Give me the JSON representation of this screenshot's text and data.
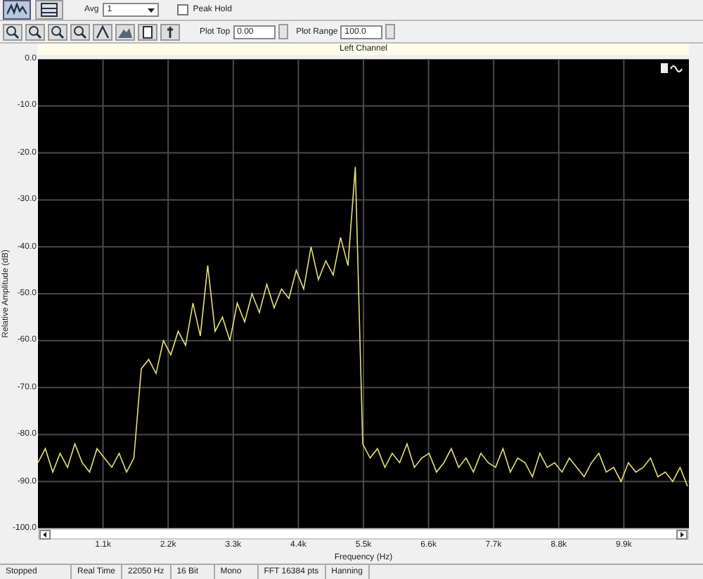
{
  "toolbar": {
    "view_buttons": [
      {
        "selected": true
      },
      {
        "selected": false
      }
    ],
    "avg": {
      "label": "Avg",
      "value": "1"
    },
    "peak_hold": {
      "label": "Peak Hold",
      "checked": false
    },
    "plot_top": {
      "label": "Plot Top",
      "value": "0.00"
    },
    "plot_range": {
      "label": "Plot Range",
      "value": "100.0"
    }
  },
  "plot": {
    "chart_data": {
      "type": "line",
      "title": "Left Channel",
      "xlabel": "Frequency (Hz)",
      "ylabel": "Relative Amplitude (dB)",
      "x": [
        0,
        125,
        250,
        375,
        500,
        625,
        750,
        875,
        1000,
        1125,
        1250,
        1375,
        1500,
        1625,
        1750,
        1875,
        2000,
        2125,
        2250,
        2375,
        2500,
        2625,
        2750,
        2875,
        3000,
        3125,
        3250,
        3375,
        3500,
        3625,
        3750,
        3875,
        4000,
        4125,
        4250,
        4375,
        4500,
        4625,
        4750,
        4875,
        5000,
        5125,
        5250,
        5375,
        5500,
        5625,
        5750,
        5875,
        6000,
        6125,
        6250,
        6375,
        6500,
        6625,
        6750,
        6875,
        7000,
        7125,
        7250,
        7375,
        7500,
        7625,
        7750,
        7875,
        8000,
        8125,
        8250,
        8375,
        8500,
        8625,
        8750,
        8875,
        9000,
        9125,
        9250,
        9375,
        9500,
        9625,
        9750,
        9875,
        10000,
        10125,
        10250,
        10375,
        10500,
        10625,
        10750,
        10875,
        11000
      ],
      "grid": true,
      "series": [
        {
          "color": "#e8e070",
          "values": [
            -86,
            -83,
            -88,
            -84,
            -87,
            -82,
            -86,
            -88,
            -83,
            -85,
            -87,
            -84,
            -88,
            -85,
            -66,
            -64,
            -67,
            -60,
            -63,
            -58,
            -61,
            -52,
            -59,
            -44,
            -58,
            -55,
            -60,
            -52,
            -56,
            -50,
            -54,
            -48,
            -53,
            -49,
            -51,
            -45,
            -49,
            -40,
            -47,
            -43,
            -46,
            -38,
            -44,
            -23,
            -82,
            -85,
            -83,
            -87,
            -84,
            -86,
            -82,
            -87,
            -85,
            -84,
            -88,
            -86,
            -83,
            -87,
            -85,
            -88,
            -84,
            -86,
            -87,
            -83,
            -88,
            -85,
            -86,
            -89,
            -84,
            -87,
            -86,
            -88,
            -85,
            -87,
            -89,
            -86,
            -84,
            -88,
            -87,
            -90,
            -86,
            -88,
            -87,
            -85,
            -89,
            -88,
            -90,
            -87,
            -91
          ]
        }
      ],
      "xlim": [
        0,
        11025
      ],
      "ylim": [
        -100,
        0
      ],
      "xticks": [
        {
          "value": 1102.5,
          "label": "1.1k"
        },
        {
          "value": 2205,
          "label": "2.2k"
        },
        {
          "value": 3307.5,
          "label": "3.3k"
        },
        {
          "value": 4410,
          "label": "4.4k"
        },
        {
          "value": 5512.5,
          "label": "5.5k"
        },
        {
          "value": 6615,
          "label": "6.6k"
        },
        {
          "value": 7717.5,
          "label": "7.7k"
        },
        {
          "value": 8820,
          "label": "8.8k"
        },
        {
          "value": 9922.5,
          "label": "9.9k"
        }
      ],
      "yticks": [
        {
          "value": 0,
          "label": "0.0"
        },
        {
          "value": -10,
          "label": "-10.0"
        },
        {
          "value": -20,
          "label": "-20.0"
        },
        {
          "value": -30,
          "label": "-30.0"
        },
        {
          "value": -40,
          "label": "-40.0"
        },
        {
          "value": -50,
          "label": "-50.0"
        },
        {
          "value": -60,
          "label": "-60.0"
        },
        {
          "value": -70,
          "label": "-70.0"
        },
        {
          "value": -80,
          "label": "-80.0"
        },
        {
          "value": -90,
          "label": "-90.0"
        },
        {
          "value": -100,
          "label": "-100.0"
        }
      ]
    }
  },
  "status_bar": [
    "Stopped",
    "Real Time",
    "22050 Hz",
    "16 Bit",
    "Mono",
    "FFT 16384 pts",
    "Hanning"
  ]
}
